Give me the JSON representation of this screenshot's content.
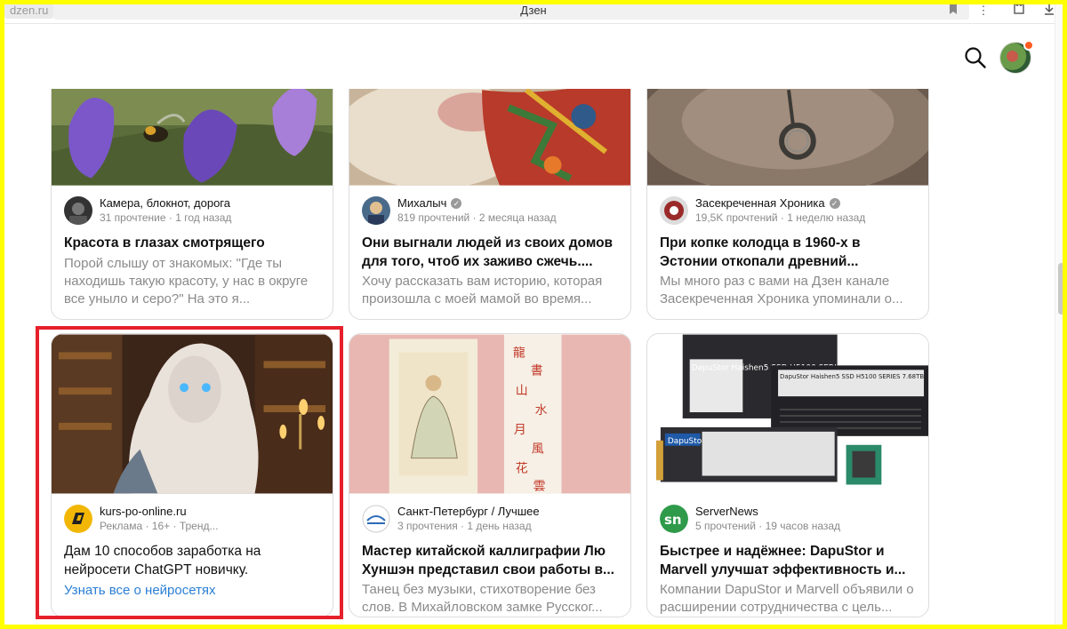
{
  "browser": {
    "url": "dzen.ru",
    "tab_title": "Дзен",
    "icons": [
      "bookmark-icon",
      "menu-dots-icon",
      "extensions-icon",
      "download-icon"
    ]
  },
  "header": {
    "icons": [
      "search-icon",
      "user-avatar"
    ],
    "notification_color": "#ff5a1f"
  },
  "colors": {
    "frame": "#ffff00",
    "highlight": "#e5202b",
    "link": "#2a7fd4",
    "muted": "#8a8a8a"
  },
  "feed": {
    "cards": [
      {
        "channel": "Камера, блокнот, дорога",
        "stats": "31 прочтение · 1 год назад",
        "title": "Красота в глазах смотрящего",
        "snippet": "Порой слышу от знакомых: \"Где ты находишь такую красоту, у нас в округе все уныло и серо?\" На это я..."
      },
      {
        "channel": "Михалыч",
        "verified": true,
        "stats": "819 прочтений · 2 месяца назад",
        "title": "Они выгнали людей из своих домов для того, чтоб их заживо сжечь....",
        "snippet": "Хочу рассказать  вам историю, которая произошла с моей мамой во время..."
      },
      {
        "channel": "Засекреченная Хроника",
        "verified": true,
        "stats": "19,5K прочтений · 1 неделю назад",
        "title": "При копке колодца в 1960-х в Эстонии откопали древний...",
        "snippet": "Мы много раз с вами на Дзен канале Засекреченная Хроника упоминали о..."
      },
      {
        "channel": "kurs-po-online.ru",
        "stats": "Реклама · 16+ · Тренд...",
        "title": "Дам 10 способов заработка на нейросети ChatGPT новичку.",
        "cta": "Узнать все о нейросетях",
        "ad": true
      },
      {
        "channel": "Санкт-Петербург / Лучшее",
        "stats": "3 прочтения · 1 день назад",
        "title": "Мастер китайской каллиграфии Лю Хуншэн представил свои работы в...",
        "snippet": "Танец без музыки, стихотворение без слов. В Михайловском замке Русског..."
      },
      {
        "channel": "ServerNews",
        "stats": "5 прочтений · 19 часов назад",
        "title": "Быстрее и надёжнее: DapuStor и Marvell улучшат эффективность и...",
        "snippet": "Компании DapuStor и Marvell объявили о расширении сотрудничества с цель..."
      }
    ],
    "ssd_labels": {
      "brand": "DapuStor",
      "series_1": "DapuStor Haishen5 SSD H5100 SERIES 7.68TB",
      "series_2": "DapuStor Haishen5 SSD H5100 SERIES 7.68TB"
    },
    "servernews_logo": "sn"
  }
}
